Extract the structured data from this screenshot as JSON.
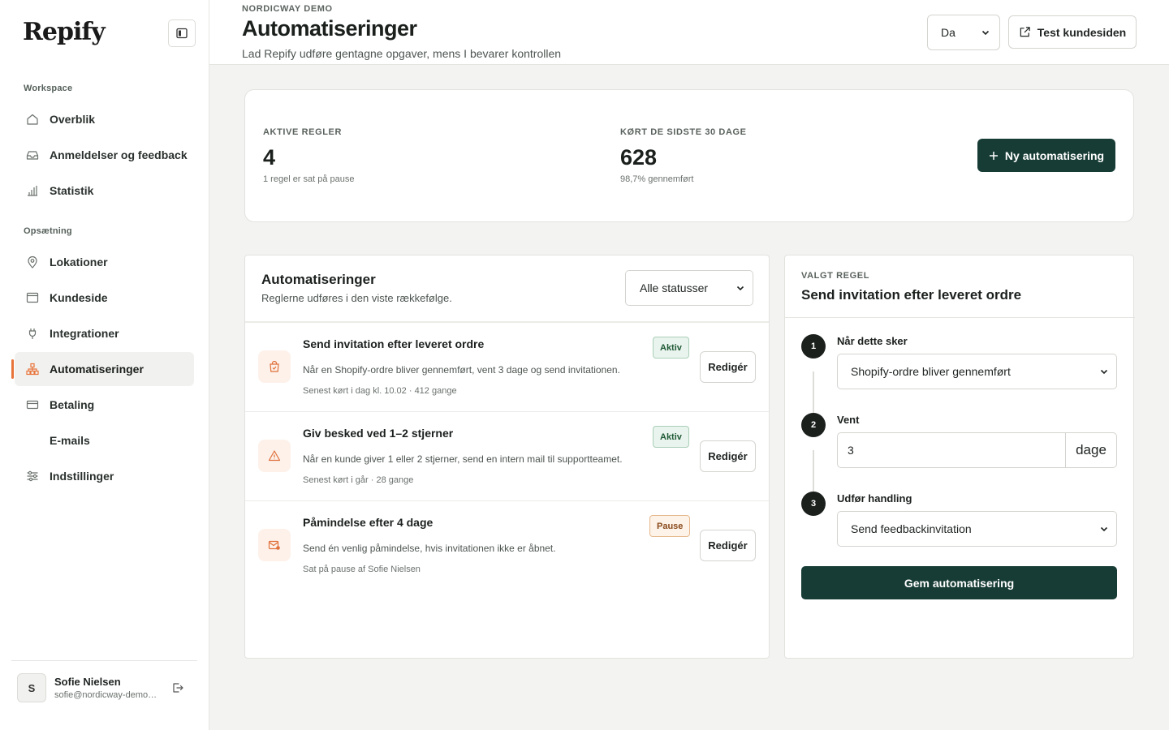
{
  "app": {
    "logo": "Repify"
  },
  "sidebar": {
    "sections": [
      {
        "label": "Workspace"
      },
      {
        "label": "Opsætning"
      }
    ],
    "items": [
      {
        "label": "Overblik",
        "icon": "home-icon"
      },
      {
        "label": "Anmeldelser og feedback",
        "icon": "inbox-icon"
      },
      {
        "label": "Statistik",
        "icon": "bar-chart-icon"
      },
      {
        "label": "Lokationer",
        "icon": "map-pin-icon"
      },
      {
        "label": "Kundeside",
        "icon": "browser-window-icon"
      },
      {
        "label": "Integrationer",
        "icon": "plug-icon"
      },
      {
        "label": "Automatiseringer",
        "icon": "workflow-icon",
        "active": true
      },
      {
        "label": "Betaling",
        "icon": "credit-card-icon"
      },
      {
        "label": "E-mails",
        "icon": ""
      },
      {
        "label": "Indstillinger",
        "icon": "sliders-icon"
      }
    ],
    "user": {
      "initial": "S",
      "name": "Sofie Nielsen",
      "email": "sofie@nordicway-demo.dk"
    }
  },
  "header": {
    "eyebrow": "NORDICWAY DEMO",
    "title": "Automatiseringer",
    "subtitle": "Lad Repify udføre gentagne opgaver, mens I bevarer kontrollen",
    "language": "Da",
    "test_button": "Test kundesiden"
  },
  "stats": {
    "active_label": "AKTIVE REGLER",
    "active_value": "4",
    "active_sub": "1 regel er sat på pause",
    "runs_label": "KØRT DE SIDSTE 30 DAGE",
    "runs_value": "628",
    "runs_sub": "98,7% gennemført",
    "new_button": "Ny automatisering"
  },
  "automations": {
    "title": "Automatiseringer",
    "subtitle": "Reglerne udføres i den viste rækkefølge.",
    "status_filter": "Alle statusser",
    "edit_label": "Redigér",
    "rows": [
      {
        "title": "Send invitation efter leveret ordre",
        "description": "Når en Shopify-ordre bliver gennemført, vent 3 dage og send invitationen.",
        "meta": "Senest kørt i dag kl. 10.02 · 412 gange",
        "status": "Aktiv",
        "icon": "shopping-bag-icon"
      },
      {
        "title": "Giv besked ved 1–2 stjerner",
        "description": "Når en kunde giver 1 eller 2 stjerner, send en intern mail til supportteamet.",
        "meta": "Senest kørt i går · 28 gange",
        "status": "Aktiv",
        "icon": "warning-icon"
      },
      {
        "title": "Påmindelse efter 4 dage",
        "description": "Send én venlig påmindelse, hvis invitationen ikke er åbnet.",
        "meta": "Sat på pause af Sofie Nielsen",
        "status": "Pause",
        "icon": "mail-icon"
      }
    ]
  },
  "rule": {
    "eyebrow": "VALGT REGEL",
    "title": "Send invitation efter leveret ordre",
    "steps": [
      {
        "number": "1",
        "label": "Når dette sker",
        "value": "Shopify-ordre bliver gennemført"
      },
      {
        "number": "2",
        "label": "Vent",
        "value": "3",
        "unit": "dage"
      },
      {
        "number": "3",
        "label": "Udfør handling",
        "value": "Send feedbackinvitation"
      }
    ],
    "save_button": "Gem automatisering"
  },
  "colors": {
    "accent": "#e8743b",
    "primary": "#173c35",
    "active_badge": "#eaf4ee",
    "paused_badge": "#fdf3e8"
  }
}
